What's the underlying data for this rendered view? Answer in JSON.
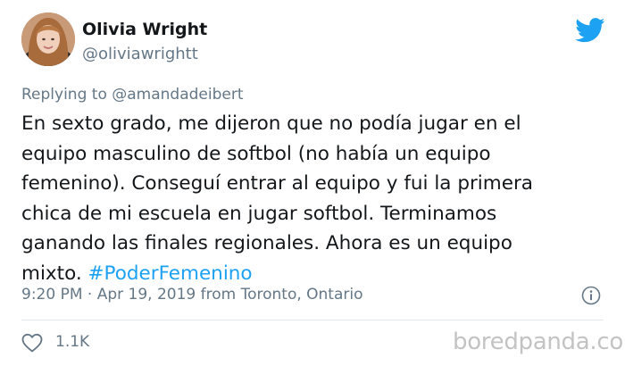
{
  "author": {
    "name": "Olivia Wright",
    "handle": "@oliviawrightt"
  },
  "reply": {
    "prefix": "Replying to ",
    "mention": "@amandadeibert"
  },
  "tweet": {
    "lines": [
      "En sexto grado, me dijeron que no podía jugar en el",
      "equipo masculino de softbol (no había un equipo",
      "femenino). Conseguí entrar al equipo y fui la primera",
      "chica de mi escuela en jugar softbol. Terminamos",
      "ganando las finales regionales. Ahora es un equipo"
    ],
    "last_line_text": "mixto. ",
    "hashtag": "#PoderFemenino"
  },
  "meta": {
    "timestamp": "9:20 PM · Apr 19, 2019 from Toronto, Ontario"
  },
  "engagement": {
    "likes": "1.1K"
  },
  "watermark": "boredpanda.com",
  "colors": {
    "twitter_blue": "#1da1f2",
    "text": "#14171a",
    "secondary": "#657786",
    "divider": "#e1e8ed"
  },
  "icons": {
    "brand": "twitter-bird-icon",
    "info": "info-icon",
    "like": "heart-icon"
  }
}
